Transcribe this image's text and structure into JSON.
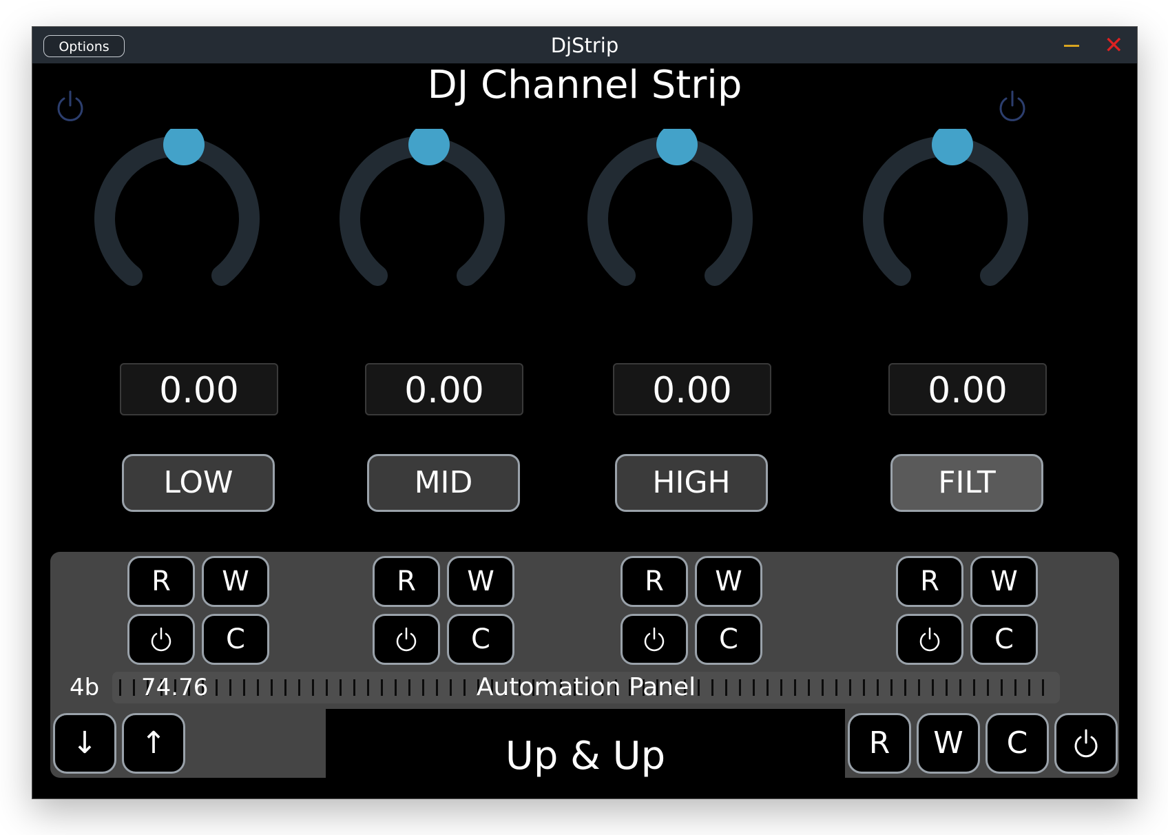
{
  "window": {
    "title": "DjStrip",
    "options_label": "Options",
    "close_glyph": "✕"
  },
  "plugin": {
    "title": "DJ Channel Strip"
  },
  "colors": {
    "accent": "#43a2c9",
    "knob_track": "#222b33",
    "power_icon": "#2c3e6e"
  },
  "bands": [
    {
      "label": "LOW",
      "value": "0.00",
      "knob_level": 0.5
    },
    {
      "label": "MID",
      "value": "0.00",
      "knob_level": 0.5
    },
    {
      "label": "HIGH",
      "value": "0.00",
      "knob_level": 0.5
    },
    {
      "label": "FILT",
      "value": "0.00",
      "knob_level": 0.5
    }
  ],
  "automation_buttons": {
    "read": "R",
    "write": "W",
    "clear": "C"
  },
  "automation": {
    "panel_label": "Automation Panel",
    "prefix": "4b",
    "value": "74.76"
  },
  "preset": {
    "name": "Up & Up",
    "prev_glyph": "↓",
    "next_glyph": "↑"
  }
}
